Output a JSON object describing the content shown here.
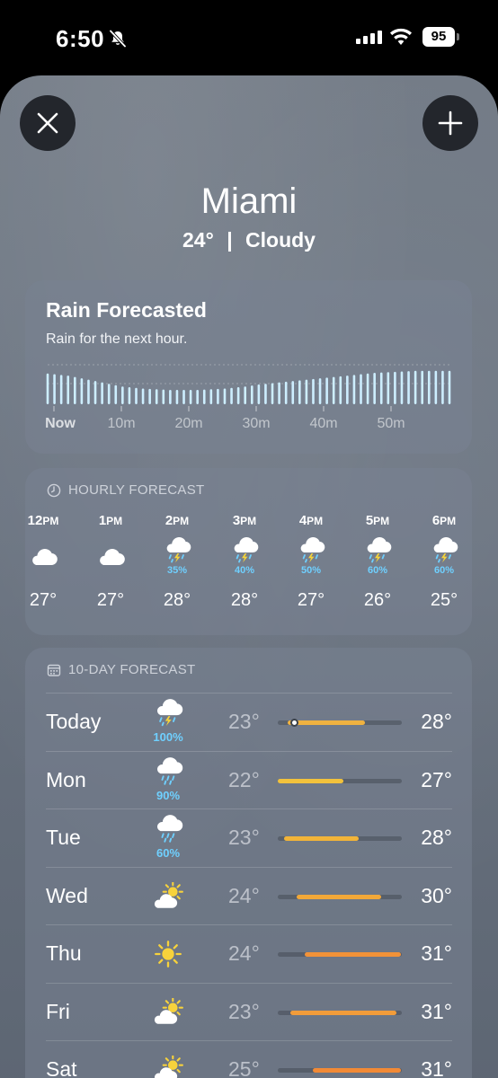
{
  "status": {
    "time": "6:50",
    "battery": "95"
  },
  "location": {
    "city": "Miami",
    "temperature": "24°",
    "separator": "|",
    "condition": "Cloudy"
  },
  "rain": {
    "title": "Rain Forecasted",
    "subtitle": "Rain for the next hour.",
    "intensity": [
      0.9,
      0.88,
      0.86,
      0.84,
      0.8,
      0.76,
      0.72,
      0.68,
      0.64,
      0.6,
      0.56,
      0.52,
      0.5,
      0.48,
      0.46,
      0.45,
      0.44,
      0.43,
      0.42,
      0.42,
      0.42,
      0.42,
      0.42,
      0.43,
      0.44,
      0.45,
      0.46,
      0.48,
      0.5,
      0.52,
      0.55,
      0.58,
      0.6,
      0.62,
      0.64,
      0.66,
      0.68,
      0.7,
      0.72,
      0.74,
      0.76,
      0.78,
      0.8,
      0.82,
      0.84,
      0.86,
      0.88,
      0.9,
      0.92,
      0.93,
      0.94,
      0.95,
      0.96,
      0.97,
      0.98,
      0.98,
      0.98,
      0.98,
      0.98,
      0.98
    ],
    "time_labels": [
      "Now",
      "10m",
      "20m",
      "30m",
      "40m",
      "50m"
    ],
    "bar_color": "#cdeeff"
  },
  "hourly": {
    "header": "HOURLY FORECAST",
    "hours": [
      {
        "hour": "12",
        "ampm": "PM",
        "icon": "cloud-icon",
        "pct": "",
        "temp": "27°"
      },
      {
        "hour": "1",
        "ampm": "PM",
        "icon": "cloud-icon",
        "pct": "",
        "temp": "27°"
      },
      {
        "hour": "2",
        "ampm": "PM",
        "icon": "thunderstorm-icon",
        "pct": "35%",
        "temp": "28°"
      },
      {
        "hour": "3",
        "ampm": "PM",
        "icon": "thunderstorm-icon",
        "pct": "40%",
        "temp": "28°"
      },
      {
        "hour": "4",
        "ampm": "PM",
        "icon": "thunderstorm-icon",
        "pct": "50%",
        "temp": "27°"
      },
      {
        "hour": "5",
        "ampm": "PM",
        "icon": "thunderstorm-icon",
        "pct": "60%",
        "temp": "26°"
      },
      {
        "hour": "6",
        "ampm": "PM",
        "icon": "thunderstorm-icon",
        "pct": "60%",
        "temp": "25°"
      }
    ]
  },
  "tenday": {
    "header": "10-DAY FORECAST",
    "days": [
      {
        "day": "Today",
        "icon": "thunderstorm-icon",
        "pct": "100%",
        "low": "23°",
        "high": "28°",
        "bar_start": 0.08,
        "bar_end": 0.7,
        "current": 0.13,
        "bar_color": "#f0b240"
      },
      {
        "day": "Mon",
        "icon": "rain-icon",
        "pct": "90%",
        "low": "22°",
        "high": "27°",
        "bar_start": 0.0,
        "bar_end": 0.53,
        "bar_color": "#f2c23c"
      },
      {
        "day": "Tue",
        "icon": "rain-icon",
        "pct": "60%",
        "low": "23°",
        "high": "28°",
        "bar_start": 0.05,
        "bar_end": 0.65,
        "bar_color": "#f2b438"
      },
      {
        "day": "Wed",
        "icon": "partly-sunny-icon",
        "pct": "",
        "low": "24°",
        "high": "30°",
        "bar_start": 0.15,
        "bar_end": 0.83,
        "bar_color": "#f2a838"
      },
      {
        "day": "Thu",
        "icon": "sun-icon",
        "pct": "",
        "low": "24°",
        "high": "31°",
        "bar_start": 0.22,
        "bar_end": 0.99,
        "bar_color": "#f29238"
      },
      {
        "day": "Fri",
        "icon": "partly-sunny-icon",
        "pct": "",
        "low": "23°",
        "high": "31°",
        "bar_start": 0.1,
        "bar_end": 0.96,
        "bar_color": "#f29c3a"
      },
      {
        "day": "Sat",
        "icon": "partly-sunny-icon",
        "pct": "",
        "low": "25°",
        "high": "31°",
        "bar_start": 0.28,
        "bar_end": 0.99,
        "bar_color": "#f28a36"
      }
    ]
  }
}
